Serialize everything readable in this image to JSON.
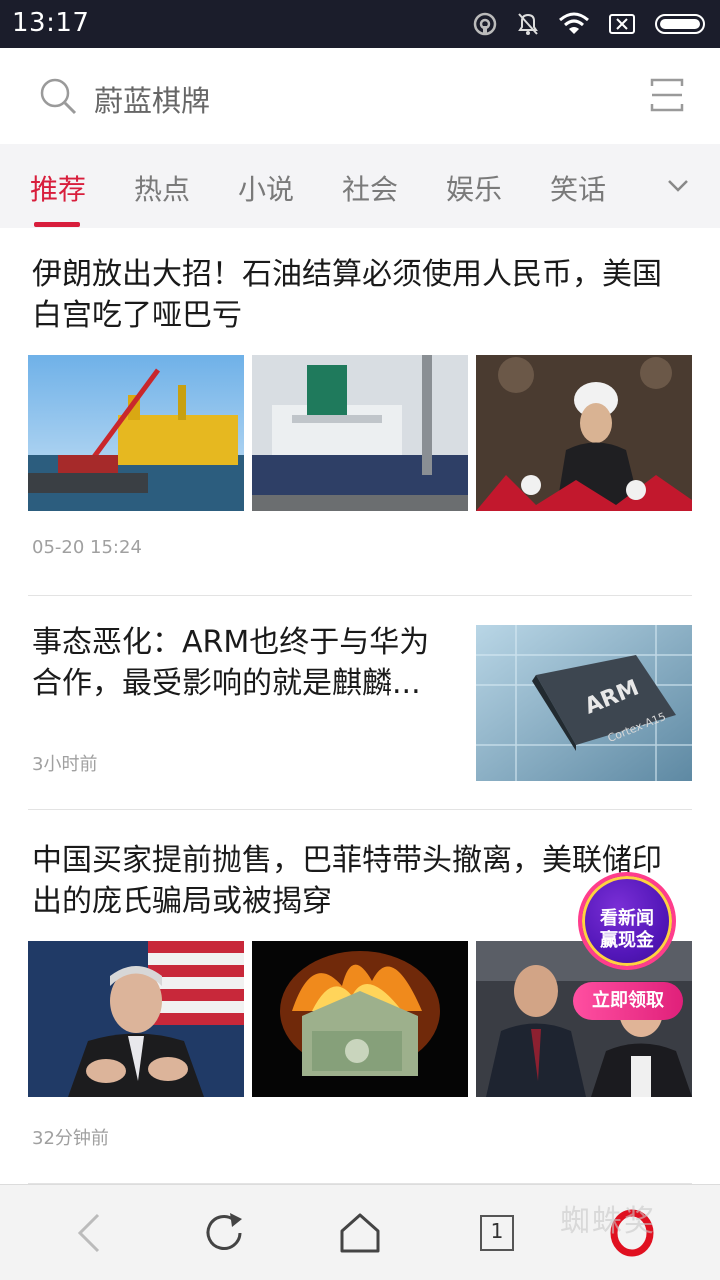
{
  "status_bar": {
    "time": "13:17"
  },
  "search": {
    "placeholder": "蔚蓝棋牌"
  },
  "tabs": [
    "推荐",
    "热点",
    "小说",
    "社会",
    "娱乐",
    "笑话"
  ],
  "articles": [
    {
      "title_line1": "伊朗放出大招！石油结算必须使用人民币，美国",
      "title_line2": "白宫吃了哑巴亏",
      "time": "05-20 15:24",
      "images": [
        "offshore-oil-platform",
        "oil-tanker-ship",
        "iranian-president-speech"
      ]
    },
    {
      "title_line1": "事态恶化：ARM也终于与华为",
      "title_line2": "合作，最受影响的就是麒麟...",
      "time": "3小时前",
      "images": [
        "arm-cortex-chip"
      ],
      "chip_label": "ARM",
      "chip_sublabel": "Cortex-A15"
    },
    {
      "title_line1": "中国买家提前抛售，巴菲特带头撤离，美联储印",
      "title_line2": "出的庞氏骗局或被揭穿",
      "time": "32分钟前",
      "images": [
        "fed-chair-portrait",
        "burning-dollar-house",
        "stock-traders"
      ]
    }
  ],
  "promo": {
    "line1": "看新闻",
    "line2": "赢现金",
    "button": "立即领取"
  },
  "bottom_nav": {
    "tab_count": "1",
    "watermark": "蜘蛛奖"
  },
  "colors": {
    "accent": "#d81e3c",
    "status_bar": "#1b1d2b",
    "tab_bar": "#f4f4f6"
  }
}
